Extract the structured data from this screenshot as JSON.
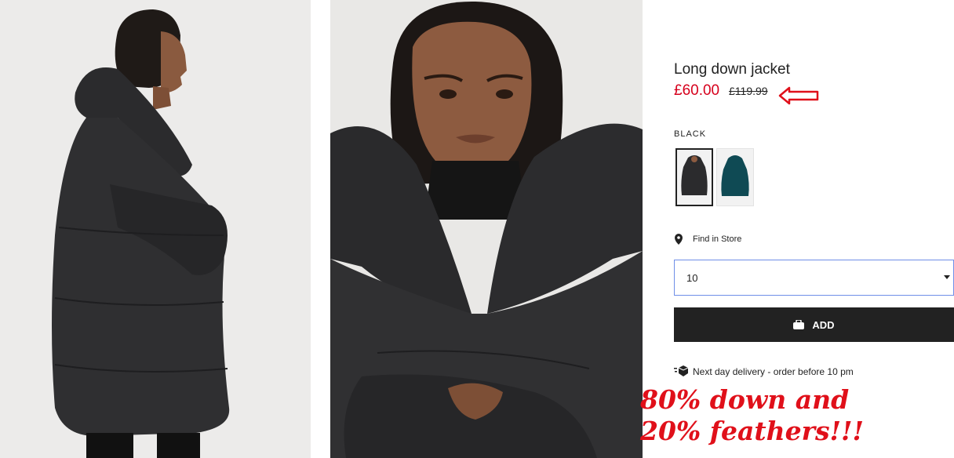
{
  "product": {
    "title": "Long down jacket",
    "sale_price": "£60.00",
    "original_price": "£119.99",
    "color_label": "BLACK",
    "color_options": [
      "black",
      "teal"
    ],
    "find_in_store": "Find in Store",
    "selected_size": "10",
    "add_button_label": "ADD",
    "delivery_text": "Next day delivery - order before 10 pm"
  },
  "annotation": {
    "line1": "80% down and",
    "line2": "20% feathers!!!"
  },
  "colors": {
    "sale_red": "#d6001c",
    "button_black": "#222222",
    "annotation_red": "#e0101a",
    "select_border": "#6f8fe8"
  },
  "icons": [
    "location-pin-icon",
    "shopping-bag-icon",
    "delivery-truck-icon",
    "left-arrow-icon"
  ]
}
